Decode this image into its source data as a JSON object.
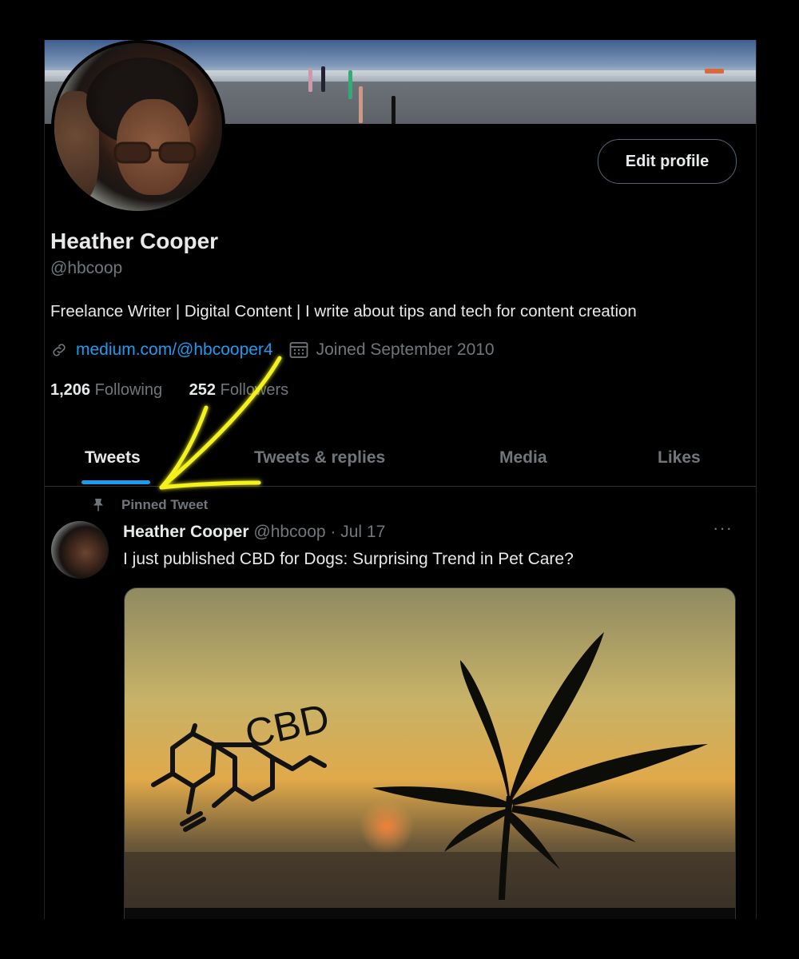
{
  "profile": {
    "name": "Heather Cooper",
    "handle": "@hbcoop",
    "bio": "Freelance Writer | Digital Content | I write about tips and tech for content creation",
    "link": "medium.com/@hbcooper4",
    "joined": "Joined September 2010",
    "following_count": "1,206",
    "following_label": "Following",
    "followers_count": "252",
    "followers_label": "Followers",
    "edit_label": "Edit profile"
  },
  "tabs": [
    {
      "label": "Tweets",
      "active": true
    },
    {
      "label": "Tweets & replies",
      "active": false
    },
    {
      "label": "Media",
      "active": false
    },
    {
      "label": "Likes",
      "active": false
    }
  ],
  "tweet": {
    "pinned_label": "Pinned Tweet",
    "author": "Heather Cooper",
    "handle_date": "@hbcoop · Jul 17",
    "text": "I just published CBD for Dogs: Surprising Trend in Pet Care?",
    "more": "···",
    "image_text": "CBD"
  },
  "icons": {
    "link": "link-icon",
    "calendar": "calendar-icon",
    "pin": "pin-icon",
    "more": "more-icon",
    "arrow": "annotation-arrow-icon"
  },
  "colors": {
    "accent": "#1d9bf0",
    "annotation": "#f4f21a",
    "background": "#000000"
  }
}
